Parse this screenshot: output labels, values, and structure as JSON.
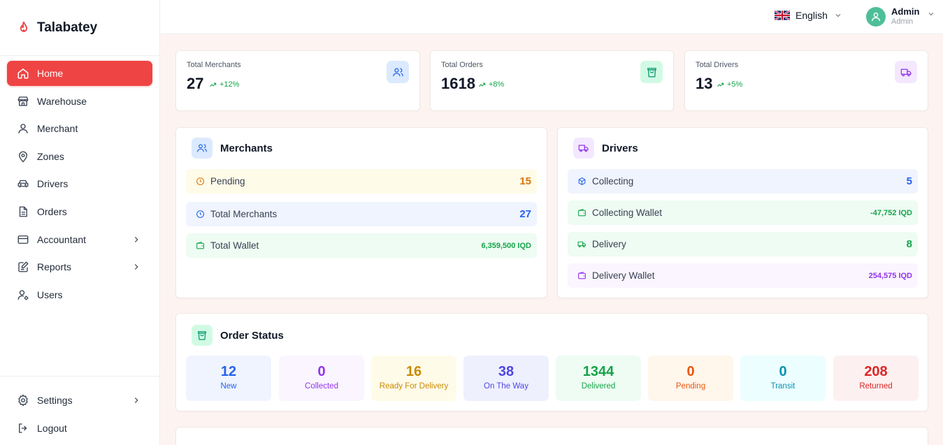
{
  "brand": {
    "name": "Talabatey"
  },
  "sidebar": {
    "items": [
      {
        "label": "Home",
        "icon": "home-icon"
      },
      {
        "label": "Warehouse",
        "icon": "warehouse-icon"
      },
      {
        "label": "Merchant",
        "icon": "user-icon"
      },
      {
        "label": "Zones",
        "icon": "map-pin-icon"
      },
      {
        "label": "Drivers",
        "icon": "car-icon"
      },
      {
        "label": "Orders",
        "icon": "document-icon"
      },
      {
        "label": "Accountant",
        "icon": "credit-card-icon"
      },
      {
        "label": "Reports",
        "icon": "edit-report-icon"
      },
      {
        "label": "Users",
        "icon": "user-gear-icon"
      }
    ],
    "bottom": [
      {
        "label": "Settings",
        "icon": "gear-icon"
      },
      {
        "label": "Logout",
        "icon": "logout-icon"
      }
    ]
  },
  "header": {
    "language": "English",
    "user": {
      "name": "Admin",
      "role": "Admin"
    }
  },
  "stats": [
    {
      "label": "Total Merchants",
      "value": "27",
      "trend": "+12%",
      "icon": "users-icon"
    },
    {
      "label": "Total Orders",
      "value": "1618",
      "trend": "+8%",
      "icon": "shopping-bag-icon"
    },
    {
      "label": "Total Drivers",
      "value": "13",
      "trend": "+5%",
      "icon": "truck-icon"
    }
  ],
  "merchants_panel": {
    "title": "Merchants",
    "rows": [
      {
        "label": "Pending",
        "value": "15"
      },
      {
        "label": "Total Merchants",
        "value": "27"
      },
      {
        "label": "Total Wallet",
        "value": "6,359,500 IQD"
      }
    ]
  },
  "drivers_panel": {
    "title": "Drivers",
    "rows": [
      {
        "label": "Collecting",
        "value": "5"
      },
      {
        "label": "Collecting Wallet",
        "value": "-47,752 IQD"
      },
      {
        "label": "Delivery",
        "value": "8"
      },
      {
        "label": "Delivery Wallet",
        "value": "254,575 IQD"
      }
    ]
  },
  "order_status": {
    "title": "Order Status",
    "items": [
      {
        "value": "12",
        "label": "New"
      },
      {
        "value": "0",
        "label": "Collected"
      },
      {
        "value": "16",
        "label": "Ready For Delivery"
      },
      {
        "value": "38",
        "label": "On The Way"
      },
      {
        "value": "1344",
        "label": "Delivered"
      },
      {
        "value": "0",
        "label": "Pending"
      },
      {
        "value": "0",
        "label": "Transit"
      },
      {
        "value": "208",
        "label": "Returned"
      }
    ]
  },
  "colors": {
    "accent": "#ef4444",
    "background": "#fdf4f2"
  }
}
